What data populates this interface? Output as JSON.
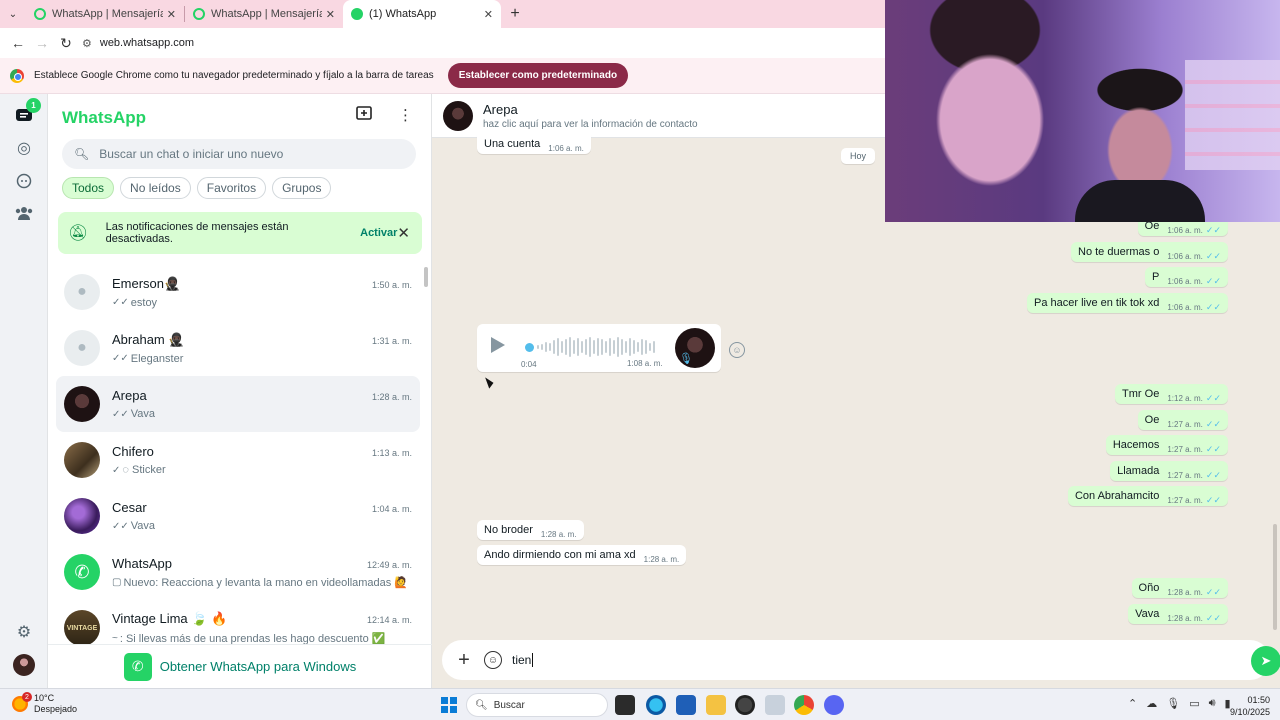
{
  "browser": {
    "tabs": [
      {
        "title": "WhatsApp | Mensajería y llamadas",
        "active": false
      },
      {
        "title": "WhatsApp | Mensajería y llamadas",
        "active": false
      },
      {
        "title": "(1) WhatsApp",
        "active": true
      }
    ],
    "new_tab_label": "+",
    "url": "web.whatsapp.com",
    "infobar_text": "Establece Google Chrome como tu navegador predeterminado y fíjalo a la barra de tareas",
    "infobar_button": "Establecer como predeterminado"
  },
  "rail": {
    "chats_badge": "1"
  },
  "panel": {
    "brand": "WhatsApp",
    "search_placeholder": "Buscar un chat o iniciar uno nuevo",
    "filters": [
      "Todos",
      "No leídos",
      "Favoritos",
      "Grupos"
    ],
    "notification": {
      "text": "Las notificaciones de mensajes están desactivadas.",
      "action": "Activar"
    },
    "chats": [
      {
        "name": "Emerson🥷🏿",
        "time": "1:50 a. m.",
        "tick": "✓✓",
        "preview": "estoy",
        "avatar": "default"
      },
      {
        "name": "Abraham 🥷🏿",
        "time": "1:31 a. m.",
        "tick": "✓✓",
        "preview": "Eleganster",
        "avatar": "default"
      },
      {
        "name": "Arepa",
        "time": "1:28 a. m.",
        "tick": "✓✓",
        "preview": "Vava",
        "avatar": "dark",
        "selected": true
      },
      {
        "name": "Chifero",
        "time": "1:13 a. m.",
        "tick": "✓",
        "preview": "◌ Sticker",
        "avatar": "brown"
      },
      {
        "name": "Cesar",
        "time": "1:04 a. m.",
        "tick": "✓✓",
        "preview": "Vava",
        "avatar": "purple"
      },
      {
        "name": "WhatsApp",
        "time": "12:49 a. m.",
        "tick": "▢",
        "preview": "Nuevo: Reacciona y levanta la mano en videollamadas 🙋 ...",
        "avatar": "wa"
      },
      {
        "name": "Vintage Lima 🍃 🔥",
        "time": "12:14 a. m.",
        "tick": "~",
        "preview": "     : Si llevas más de una prendas les hago descuento ✅",
        "avatar": "vintage"
      }
    ],
    "get_app": "Obtener WhatsApp para Windows"
  },
  "conversation": {
    "contact_name": "Arepa",
    "contact_sub": "haz clic aquí para ver la información de contacto",
    "date_chip": "Hoy",
    "messages": [
      {
        "dir": "in",
        "text": "Una cuenta",
        "time": "1:06 a. m."
      },
      {
        "dir": "out",
        "text": "Oe",
        "time": "1:06 a. m."
      },
      {
        "dir": "out",
        "text": "No te duermas o",
        "time": "1:06 a. m."
      },
      {
        "dir": "out",
        "text": "P",
        "time": "1:06 a. m."
      },
      {
        "dir": "out",
        "text": "Pa hacer live en tik tok xd",
        "time": "1:06 a. m."
      },
      {
        "dir": "out",
        "text": "Tmr Oe",
        "time": "1:12 a. m."
      },
      {
        "dir": "out",
        "text": "Oe",
        "time": "1:27 a. m."
      },
      {
        "dir": "out",
        "text": "Hacemos",
        "time": "1:27 a. m."
      },
      {
        "dir": "out",
        "text": "Llamada",
        "time": "1:27 a. m."
      },
      {
        "dir": "out",
        "text": "Con Abrahamcito",
        "time": "1:27 a. m."
      },
      {
        "dir": "in",
        "text": "No broder",
        "time": "1:28 a. m."
      },
      {
        "dir": "in",
        "text": "Ando dirmiendo con mi ama xd",
        "time": "1:28 a. m."
      },
      {
        "dir": "out",
        "text": "Oño",
        "time": "1:28 a. m."
      },
      {
        "dir": "out",
        "text": "Vava",
        "time": "1:28 a. m."
      }
    ],
    "voice_note": {
      "duration": "0:04",
      "time": "1:08 a. m.",
      "progress": 0.0
    },
    "composer_text": "tien"
  },
  "taskbar": {
    "weather_temp": "10°C",
    "weather_desc": "Despejado",
    "weather_badge": "2",
    "search_label": "Buscar",
    "time": "01:50",
    "date": "9/10/2025"
  },
  "colors": {
    "brand_green": "#25d366",
    "outgoing_bubble": "#d9fdd3",
    "chat_background": "#efeae2",
    "read_tick": "#53bdeb"
  }
}
